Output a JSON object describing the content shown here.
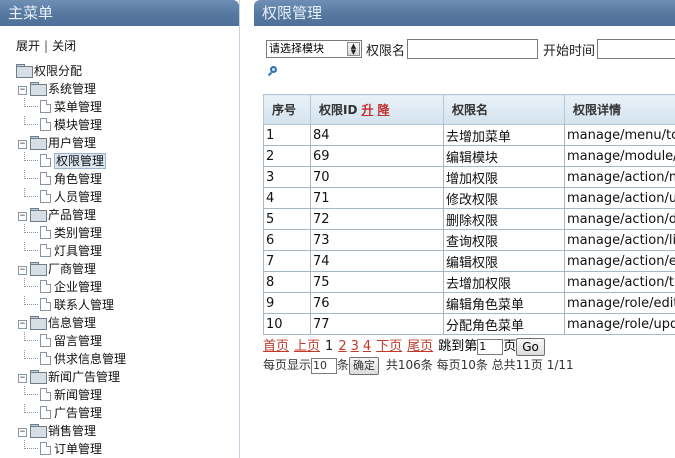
{
  "left_panel": {
    "title": "主菜单",
    "expand_label": "展开",
    "collapse_label": "关闭",
    "separator": "|"
  },
  "tree": {
    "root": "权限分配",
    "groups": [
      {
        "label": "系统管理",
        "items": [
          "菜单管理",
          "模块管理"
        ]
      },
      {
        "label": "用户管理",
        "items": [
          "权限管理",
          "角色管理",
          "人员管理"
        ]
      },
      {
        "label": "产品管理",
        "items": [
          "类别管理",
          "灯具管理"
        ]
      },
      {
        "label": "厂商管理",
        "items": [
          "企业管理",
          "联系人管理"
        ]
      },
      {
        "label": "信息管理",
        "items": [
          "留言管理",
          "供求信息管理"
        ]
      },
      {
        "label": "新闻广告管理",
        "items": [
          "新闻管理",
          "广告管理"
        ]
      },
      {
        "label": "销售管理",
        "items": [
          "订单管理"
        ]
      }
    ],
    "selected_item": "权限管理"
  },
  "right_panel": {
    "title": "权限管理",
    "search": {
      "module_select_value": "请选择模块",
      "name_label": "权限名",
      "name_value": "",
      "start_time_label": "开始时间",
      "start_time_value": ""
    }
  },
  "table": {
    "headers": [
      "序号",
      "权限ID",
      "权限名",
      "权限详情"
    ],
    "sort_asc": "升",
    "sort_desc": "降",
    "rows": [
      [
        "1",
        "84",
        "去增加菜单",
        "manage/menu/tc"
      ],
      [
        "2",
        "69",
        "编辑模块",
        "manage/module/"
      ],
      [
        "3",
        "70",
        "增加权限",
        "manage/action/n"
      ],
      [
        "4",
        "71",
        "修改权限",
        "manage/action/u"
      ],
      [
        "5",
        "72",
        "删除权限",
        "manage/action/d"
      ],
      [
        "6",
        "73",
        "查询权限",
        "manage/action/li"
      ],
      [
        "7",
        "74",
        "编辑权限",
        "manage/action/e"
      ],
      [
        "8",
        "75",
        "去增加权限",
        "manage/action/t"
      ],
      [
        "9",
        "76",
        "编辑角色菜单",
        "manage/role/edit"
      ],
      [
        "10",
        "77",
        "分配角色菜单",
        "manage/role/upd"
      ]
    ]
  },
  "pager": {
    "first": "首页",
    "prev": "上页",
    "current_page": "1",
    "pages": [
      "2",
      "3",
      "4"
    ],
    "next": "下页",
    "last": "尾页",
    "jump_prefix": "跳到第",
    "jump_value": "1",
    "jump_suffix": "页",
    "go_label": "Go",
    "per_page_prefix": "每页显示",
    "per_page_value": "10",
    "per_page_suffix": "条",
    "confirm_label": "确定",
    "summary": "共106条 每页10条 总共11页 1/11"
  },
  "colors": {
    "header_bar": "#56789f",
    "link_red": "#c0392b",
    "table_header": "#d2e2ee"
  }
}
